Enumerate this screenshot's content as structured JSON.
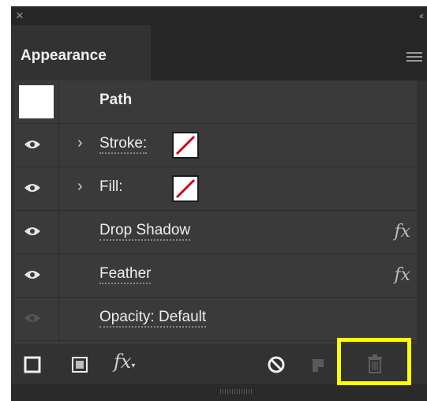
{
  "panel": {
    "title_close_glyph": "×",
    "collapse_glyph": "‹‹",
    "tab_label": "Appearance"
  },
  "rows": [
    {
      "label": "Path",
      "has_eye": false,
      "has_chevron": false,
      "swatch": "thumbnail"
    },
    {
      "label": "Stroke:",
      "has_eye": true,
      "has_chevron": true,
      "swatch": "none"
    },
    {
      "label": "Fill:",
      "has_eye": true,
      "has_chevron": true,
      "swatch": "none"
    },
    {
      "label": "Drop Shadow",
      "has_eye": true,
      "fx": "fx"
    },
    {
      "label": "Feather",
      "has_eye": true,
      "fx": "fx"
    },
    {
      "label": "Opacity: Default",
      "has_eye": true,
      "eye_dim": true
    }
  ],
  "toolbar": {
    "fx_label": "fx",
    "icons": [
      "add-new-stroke-icon",
      "add-new-fill-icon",
      "add-new-effect-icon",
      "clear-appearance-icon",
      "duplicate-item-icon",
      "delete-item-icon"
    ]
  },
  "colors": {
    "panel_bg": "#323232",
    "highlight": "#ffff00",
    "none_slash": "#d0021b"
  }
}
